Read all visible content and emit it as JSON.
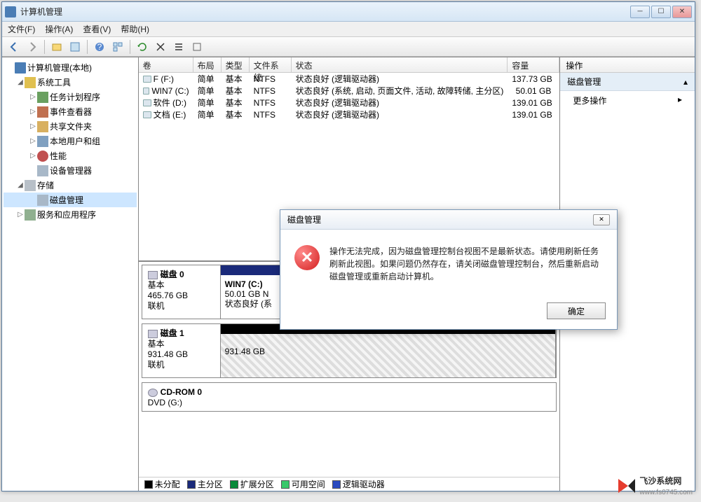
{
  "titlebar": {
    "title": "计算机管理"
  },
  "menubar": {
    "file": "文件(F)",
    "action": "操作(A)",
    "view": "查看(V)",
    "help": "帮助(H)"
  },
  "tree": {
    "root": "计算机管理(本地)",
    "system_tools": "系统工具",
    "task_scheduler": "任务计划程序",
    "event_viewer": "事件查看器",
    "shared_folders": "共享文件夹",
    "local_users": "本地用户和组",
    "performance": "性能",
    "device_manager": "设备管理器",
    "storage": "存储",
    "disk_management": "磁盘管理",
    "services": "服务和应用程序"
  },
  "vol_headers": {
    "vol": "卷",
    "layout": "布局",
    "type": "类型",
    "fs": "文件系统",
    "status": "状态",
    "cap": "容量"
  },
  "volumes": [
    {
      "name": "F (F:)",
      "layout": "简单",
      "type": "基本",
      "fs": "NTFS",
      "status": "状态良好 (逻辑驱动器)",
      "cap": "137.73 GB"
    },
    {
      "name": "WIN7 (C:)",
      "layout": "简单",
      "type": "基本",
      "fs": "NTFS",
      "status": "状态良好 (系统, 启动, 页面文件, 活动, 故障转储, 主分区)",
      "cap": "50.01 GB"
    },
    {
      "name": "软件 (D:)",
      "layout": "简单",
      "type": "基本",
      "fs": "NTFS",
      "status": "状态良好 (逻辑驱动器)",
      "cap": "139.01 GB"
    },
    {
      "name": "文档 (E:)",
      "layout": "简单",
      "type": "基本",
      "fs": "NTFS",
      "status": "状态良好 (逻辑驱动器)",
      "cap": "139.01 GB"
    }
  ],
  "disks": {
    "disk0": {
      "title": "磁盘 0",
      "type": "基本",
      "size": "465.76 GB",
      "status": "联机"
    },
    "disk0_part": {
      "name": "WIN7  (C:)",
      "size": "50.01 GB N",
      "status": "状态良好 (系"
    },
    "disk1": {
      "title": "磁盘 1",
      "type": "基本",
      "size": "931.48 GB",
      "status": "联机"
    },
    "disk1_part": {
      "size": "931.48 GB"
    },
    "cdrom": {
      "title": "CD-ROM 0",
      "sub": "DVD (G:)"
    }
  },
  "legend": {
    "unallocated": "未分配",
    "primary": "主分区",
    "extended": "扩展分区",
    "free": "可用空间",
    "logical": "逻辑驱动器"
  },
  "actions": {
    "header": "操作",
    "disk_mgmt": "磁盘管理",
    "more": "更多操作"
  },
  "dialog": {
    "title": "磁盘管理",
    "message": "操作无法完成，因为磁盘管理控制台视图不是最新状态。请使用刷新任务刷新此视图。如果问题仍然存在，请关闭磁盘管理控制台，然后重新启动磁盘管理或重新启动计算机。",
    "ok": "确定"
  },
  "watermark": {
    "name": "飞沙系统网",
    "url": "www.fs0745.com"
  }
}
